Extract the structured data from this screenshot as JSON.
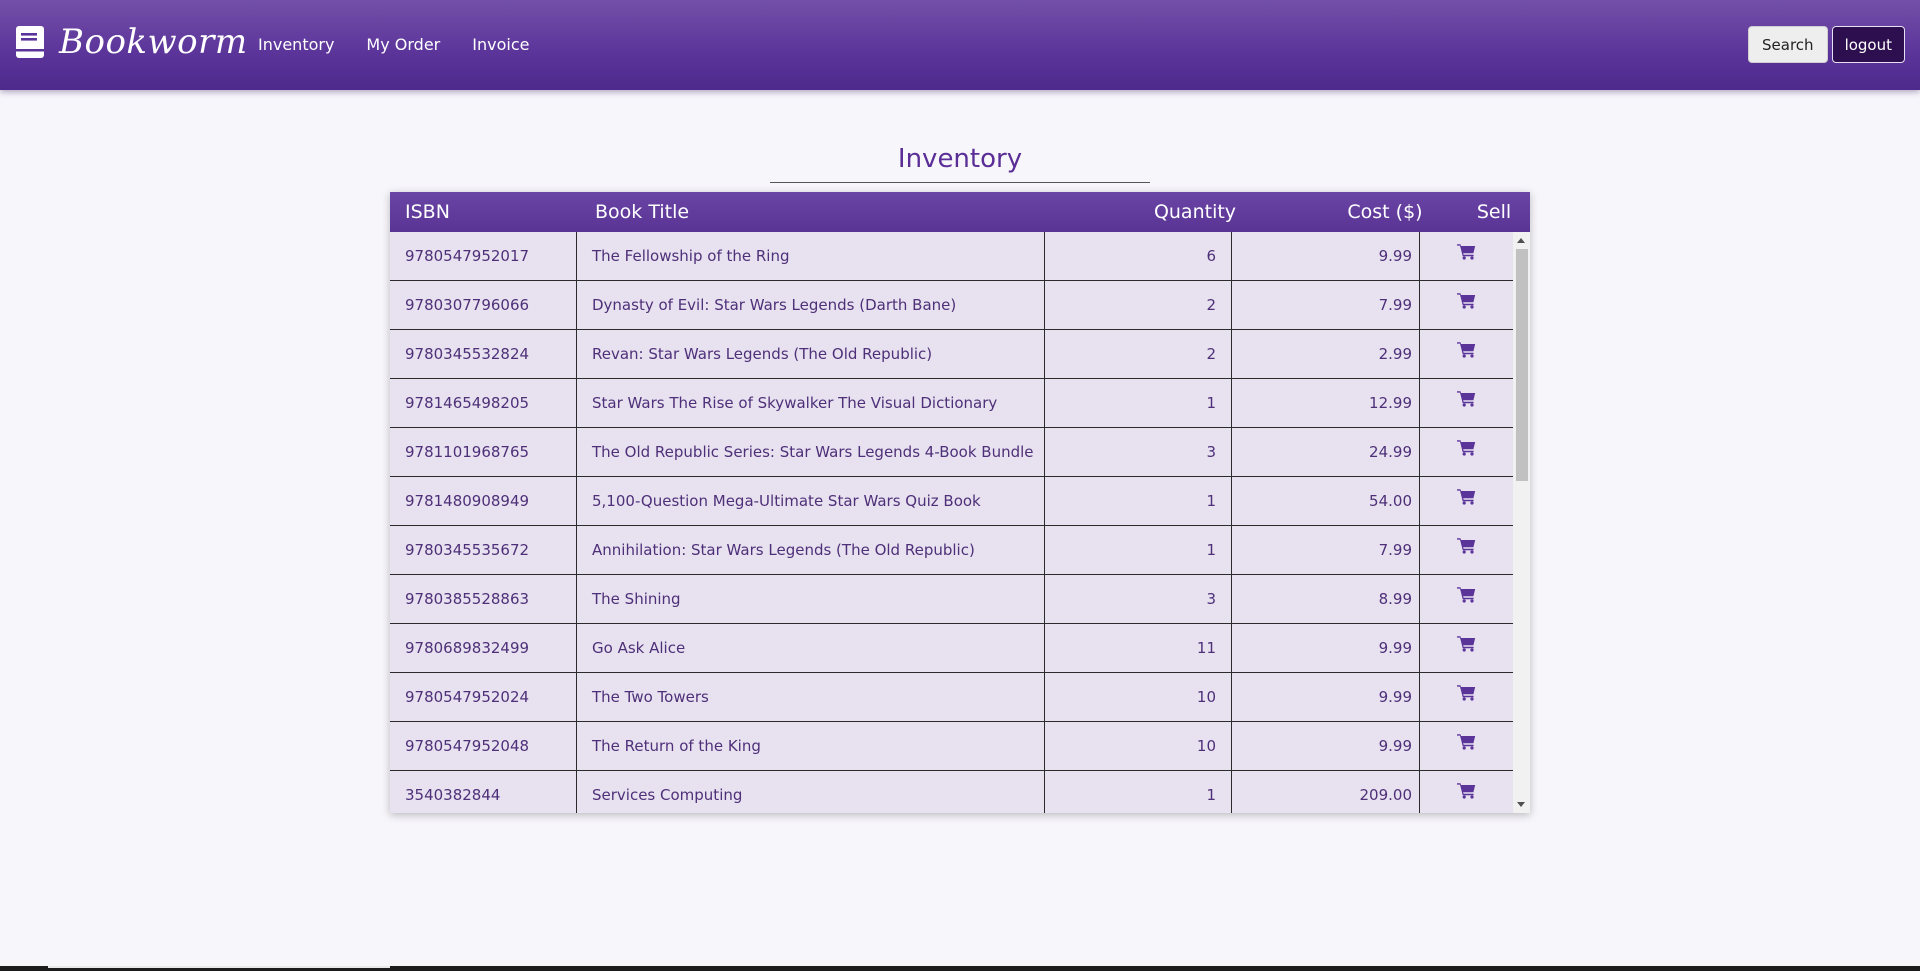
{
  "app": {
    "brand": "Bookworm",
    "icon": "book-icon"
  },
  "nav": {
    "links": [
      "Inventory",
      "My Order",
      "Invoice"
    ],
    "search_label": "Search",
    "logout_label": "logout"
  },
  "main": {
    "title": "Inventory",
    "columns": {
      "isbn": "ISBN",
      "title": "Book Title",
      "quantity": "Quantity",
      "cost": "Cost ($)",
      "sell": "Sell"
    },
    "rows": [
      {
        "isbn": "9780547952017",
        "title": "The Fellowship of the Ring",
        "quantity": "6",
        "cost": "9.99"
      },
      {
        "isbn": "9780307796066",
        "title": "Dynasty of Evil: Star Wars Legends (Darth Bane)",
        "quantity": "2",
        "cost": "7.99"
      },
      {
        "isbn": "9780345532824",
        "title": "Revan: Star Wars Legends (The Old Republic)",
        "quantity": "2",
        "cost": "2.99"
      },
      {
        "isbn": "9781465498205",
        "title": "Star Wars The Rise of Skywalker The Visual Dictionary",
        "quantity": "1",
        "cost": "12.99"
      },
      {
        "isbn": "9781101968765",
        "title": "The Old Republic Series: Star Wars Legends 4-Book Bundle",
        "quantity": "3",
        "cost": "24.99"
      },
      {
        "isbn": "9781480908949",
        "title": "5,100-Question Mega-Ultimate Star Wars Quiz Book",
        "quantity": "1",
        "cost": "54.00"
      },
      {
        "isbn": "9780345535672",
        "title": "Annihilation: Star Wars Legends (The Old Republic)",
        "quantity": "1",
        "cost": "7.99"
      },
      {
        "isbn": "9780385528863",
        "title": "The Shining",
        "quantity": "3",
        "cost": "8.99"
      },
      {
        "isbn": "9780689832499",
        "title": "Go Ask Alice",
        "quantity": "11",
        "cost": "9.99"
      },
      {
        "isbn": "9780547952024",
        "title": "The Two Towers",
        "quantity": "10",
        "cost": "9.99"
      },
      {
        "isbn": "9780547952048",
        "title": "The Return of the King",
        "quantity": "10",
        "cost": "9.99"
      },
      {
        "isbn": "3540382844",
        "title": "Services Computing",
        "quantity": "1",
        "cost": "209.00"
      }
    ],
    "sell_icon": "shopping-cart-icon"
  },
  "colors": {
    "navbar": "#5b349a",
    "accent": "#5a2e96",
    "row_bg": "#e7e1f0",
    "logout_bg": "#2d0f4f"
  }
}
